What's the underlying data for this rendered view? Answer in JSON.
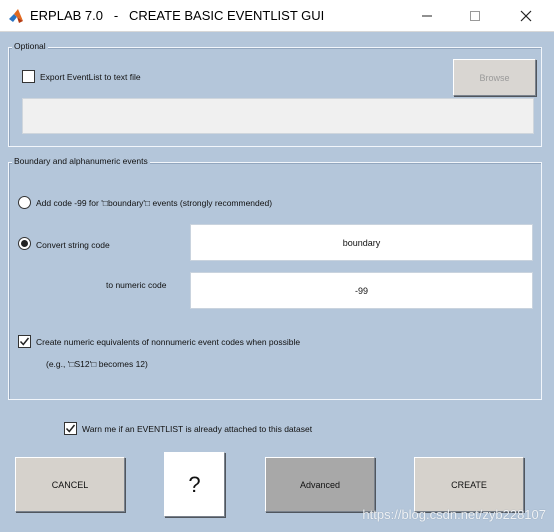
{
  "window": {
    "title": "ERPLAB 7.0   -   CREATE BASIC EVENTLIST GUI",
    "controls": [
      "minimize",
      "maximize",
      "close"
    ]
  },
  "optional_panel": {
    "legend": "Optional",
    "export_checkbox": {
      "label": "Export EventList to text file",
      "checked": false
    },
    "browse_label": "Browse",
    "file_path_value": ""
  },
  "boundary_panel": {
    "legend": "Boundary and alphanumeric events",
    "radio_add_code": {
      "label": "Add code -99 for '□boundary'□ events (strongly recommended)",
      "selected": false
    },
    "radio_convert": {
      "label": "Convert string code",
      "selected": true
    },
    "string_code_value": "boundary",
    "to_numeric_label": "to numeric code",
    "numeric_code_value": "-99",
    "numeric_equiv_checkbox": {
      "label": "Create numeric equivalents of nonnumeric event codes when possible",
      "checked": true
    },
    "example_text": "(e.g., '□S12'□ becomes 12)"
  },
  "warn_checkbox": {
    "label": "Warn me if an EVENTLIST is already attached to this dataset",
    "checked": true
  },
  "buttons": {
    "cancel": "CANCEL",
    "help": "?",
    "advanced": "Advanced",
    "create": "CREATE"
  },
  "watermark": "https://blog.csdn.net/zyb228107",
  "colors": {
    "background": "#b4c6da",
    "button_light": "#d6d2cc",
    "button_dark": "#a8a8a8",
    "disabled_button": "#d9d6d2"
  }
}
